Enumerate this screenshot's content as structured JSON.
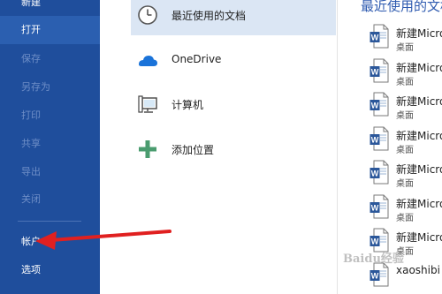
{
  "sidebar": {
    "items": [
      {
        "label": "新建",
        "enabled": true
      },
      {
        "label": "打开",
        "enabled": true,
        "selected": true
      },
      {
        "label": "保存",
        "enabled": false
      },
      {
        "label": "另存为",
        "enabled": false
      },
      {
        "label": "打印",
        "enabled": false
      },
      {
        "label": "共享",
        "enabled": false
      },
      {
        "label": "导出",
        "enabled": false
      },
      {
        "label": "关闭",
        "enabled": false
      },
      {
        "label": "帐户",
        "enabled": true
      },
      {
        "label": "选项",
        "enabled": true
      }
    ]
  },
  "locations": [
    {
      "label": "最近使用的文档",
      "icon": "clock-icon",
      "selected": true
    },
    {
      "label": "OneDrive",
      "icon": "cloud-icon"
    },
    {
      "label": "计算机",
      "icon": "computer-icon"
    },
    {
      "label": "添加位置",
      "icon": "plus-icon"
    }
  ],
  "recent": {
    "title": "最近使用的文档",
    "docs": [
      {
        "name": "新建Microsoft Word 文档",
        "location": "桌面"
      },
      {
        "name": "新建Microsoft Word 文档",
        "location": "桌面"
      },
      {
        "name": "新建Microsoft Word 文档",
        "location": "桌面"
      },
      {
        "name": "新建Microsoft Word 文档",
        "location": "桌面"
      },
      {
        "name": "新建Microsoft Word 文档",
        "location": "桌面"
      },
      {
        "name": "新建Microsoft Word 文档",
        "location": "桌面"
      },
      {
        "name": "新建Microsoft Word 文档",
        "location": "桌面"
      },
      {
        "name": "xaoshibi",
        "location": ""
      }
    ]
  },
  "annotation": {
    "arrow_color": "#e02020",
    "target": "帐户"
  },
  "watermark": "Baidu经验",
  "colors": {
    "sidebar": "#1f4e9c",
    "accent": "#2f5bb0",
    "selected_location": "#dbe6f4"
  }
}
